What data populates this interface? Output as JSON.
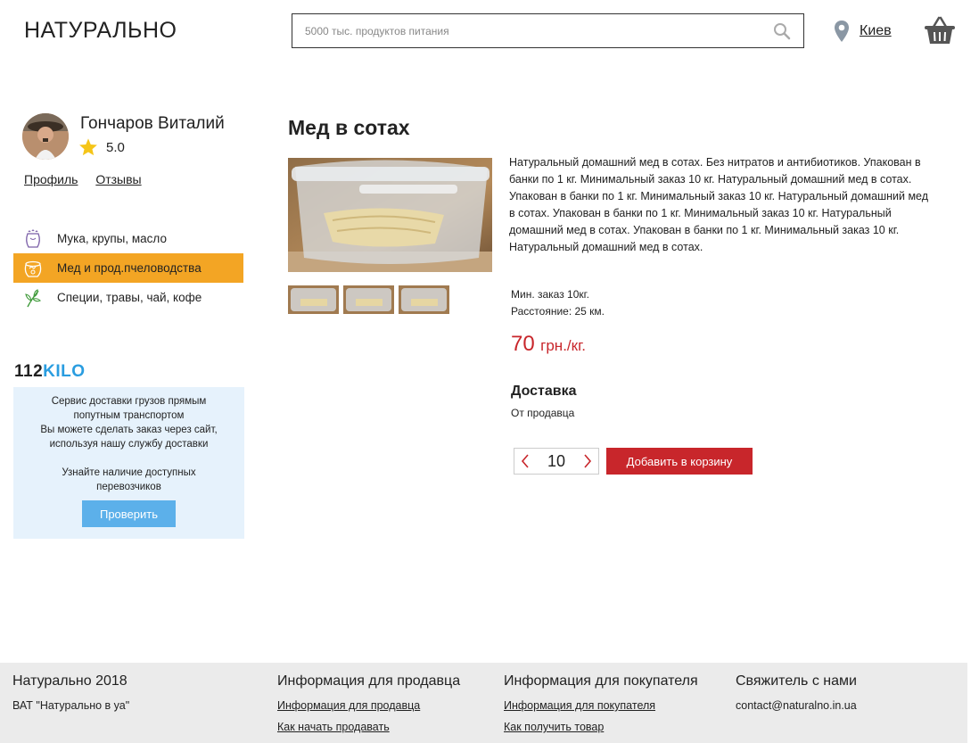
{
  "header": {
    "logo": "НАТУРАЛЬНО",
    "search_placeholder": "5000 тыс. продуктов питания",
    "city": "Киев"
  },
  "seller": {
    "name": "Гончаров Виталий",
    "rating": "5.0",
    "links": [
      "Профиль",
      "Отзывы"
    ]
  },
  "categories": [
    {
      "label": "Мука, крупы, масло",
      "icon": "flour-bag-icon",
      "active": false
    },
    {
      "label": "Мед и прод.пчеловодства",
      "icon": "honey-pot-icon",
      "active": true
    },
    {
      "label": "Специи, травы, чай, кофе",
      "icon": "herbs-icon",
      "active": false
    }
  ],
  "delivery_ad": {
    "logo_num": "112",
    "logo_word": "KILO",
    "line1": "Сервис доставки грузов прямым попутным транспортом",
    "line2": "Вы можете сделать заказ через сайт, используя нашу службу доставки",
    "line3": "Узнайте наличие доступных перевозчиков",
    "button": "Проверить"
  },
  "product": {
    "title": "Мед в сотах",
    "description": "Натуральный домашний мед в сотах. Без нитратов и антибиотиков. Упакован в банки по 1 кг. Минимальный заказ 10 кг. Натуральный домашний мед в сотах. Упакован в банки по 1 кг. Минимальный заказ 10 кг. Натуральный домашний мед в сотах. Упакован в банки по 1 кг. Минимальный заказ 10 кг. Натуральный домашний мед в сотах. Упакован в банки по 1 кг. Минимальный заказ 10 кг. Натуральный домашний мед в сотах.",
    "min_order": "Мин. заказ 10кг.",
    "distance": "Расстояние: 25 км.",
    "price": "70",
    "price_unit": "грн./кг.",
    "delivery_title": "Доставка",
    "delivery_value": "От продавца",
    "quantity": "10",
    "add_to_cart": "Добавить в корзину"
  },
  "footer": {
    "col1": {
      "title": "Натурально 2018",
      "text": "ВАТ \"Натурально в уа\""
    },
    "col2": {
      "title": "Информация для продавца",
      "links": [
        "Информация для продавца",
        "Как начать продавать"
      ]
    },
    "col3": {
      "title": "Информация для покупателя",
      "links": [
        "Информация для покупателя",
        "Как получить товар"
      ]
    },
    "col4": {
      "title": "Свяжитель с нами",
      "email": "contact@naturalno.in.ua"
    }
  },
  "colors": {
    "accent_orange": "#f3a524",
    "price_red": "#c8262b",
    "ad_bg": "#e6f2fc",
    "ad_button": "#5cb0ea",
    "footer_bg": "#ebebeb"
  }
}
